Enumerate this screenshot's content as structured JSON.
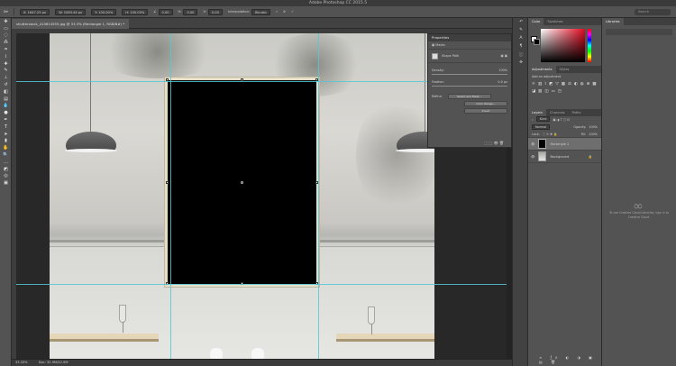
{
  "app": {
    "title": "Adobe Photoshop CC 2015.5"
  },
  "options": {
    "x": "X: 1647.25 px",
    "w": "W: 1063.44 px",
    "y": "Y: 100.00%",
    "h": "H: 100.00%",
    "angle": "0.00",
    "h_skew": "0.00",
    "v_skew": "0.00",
    "interpolation_label": "Interpolation:",
    "interpolation_value": "Bicubic",
    "search_placeholder": "Search"
  },
  "document": {
    "tab_label": "shutterstock_410614555.jpg @ 33.3% (Rectangle 1, RGB/8#) *"
  },
  "status": {
    "zoom": "33.33%",
    "doc": "Doc: 32.9M/42.9M"
  },
  "properties": {
    "title": "Properties",
    "section": "Masks",
    "mask_label": "Shape Path",
    "density_label": "Density:",
    "density_value": "100%",
    "feather_label": "Feather:",
    "feather_value": "0.0 px",
    "refine_label": "Refine:",
    "btn_select_mask": "Select and Mask...",
    "btn_color_range": "Color Range...",
    "btn_invert": "Invert"
  },
  "color_panel": {
    "tab_color": "Color",
    "tab_swatches": "Swatches",
    "fg": "#ffffff",
    "bg": "#000000",
    "accent": "#e3091f"
  },
  "adjustments": {
    "tab_adjustments": "Adjustments",
    "tab_styles": "Styles",
    "add_label": "Add an adjustment"
  },
  "layers": {
    "tab_layers": "Layers",
    "tab_channels": "Channels",
    "tab_paths": "Paths",
    "kind_label": "Kind",
    "blend_mode": "Normal",
    "opacity_label": "Opacity:",
    "opacity_value": "100%",
    "lock_label": "Lock:",
    "fill_label": "Fill:",
    "fill_value": "100%",
    "items": [
      {
        "name": "Rectangle 1",
        "selected": true
      },
      {
        "name": "Background",
        "selected": false
      }
    ]
  },
  "libraries": {
    "tab": "Libraries",
    "empty_message": "To use Creative Cloud Libraries, sign in to Creative Cloud."
  }
}
